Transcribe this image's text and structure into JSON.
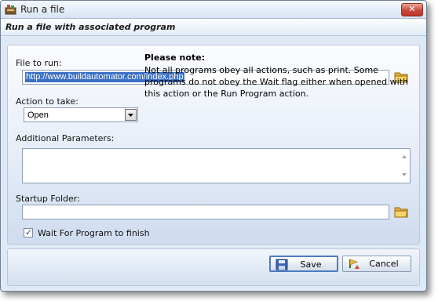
{
  "window": {
    "title": "Run a file",
    "close_symbol": "✕"
  },
  "header": {
    "text": "Run a file with associated program"
  },
  "file_to_run": {
    "label": "File to run:",
    "value": "http://www.buildautomator.com/index.php"
  },
  "action": {
    "label": "Action to take:",
    "selected": "Open"
  },
  "note": {
    "title": "Please note:",
    "body": "Not all programs obey all actions, such as print.  Some programs do not obey the Wait flag either when opened with this action or the Run Program action."
  },
  "additional_parameters": {
    "label": "Additional Parameters:",
    "value": ""
  },
  "startup_folder": {
    "label": "Startup Folder:",
    "value": ""
  },
  "wait": {
    "label": "Wait For Program to finish",
    "checked": true,
    "check_glyph": "✓"
  },
  "buttons": {
    "save": "Save",
    "cancel": "Cancel"
  },
  "icons": {
    "app": "app-icon",
    "folder": "folder-icon",
    "save": "save-disk-icon",
    "cancel": "cancel-icon"
  }
}
